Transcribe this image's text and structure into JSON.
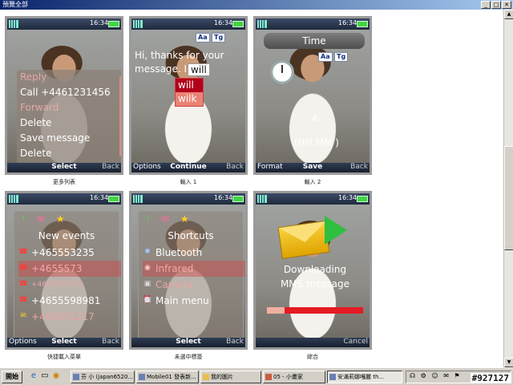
{
  "window": {
    "title": "預覽全部",
    "buttons": [
      "_",
      "□",
      "✕"
    ]
  },
  "top_captions": [
    "",
    "",
    "",
    ""
  ],
  "screens": [
    {
      "caption": "更多列表",
      "clock": "16:34",
      "softkeys": {
        "left": "",
        "center": "Select",
        "right": "Back"
      },
      "menu": [
        "Reply",
        "Call +4461231456",
        "Forward",
        "Delete",
        "Save message",
        "Delete"
      ]
    },
    {
      "caption": "輸入 1",
      "clock": "16:34",
      "badges": [
        "Aa",
        "Tg"
      ],
      "message": "Hi, thanks for your message. I",
      "cursor_word": "will",
      "suggestions": [
        "will",
        "wilk"
      ],
      "softkeys": {
        "left": "Options",
        "center": "Continue",
        "right": "Back"
      }
    },
    {
      "caption": "輸入 2",
      "clock": "16:34",
      "header": "Time",
      "badges": [
        "Aa",
        "Tg"
      ],
      "time_value": "4:",
      "time_format": "(HH:MM )",
      "softkeys": {
        "left": "Format",
        "center": "Save",
        "right": "Back"
      }
    },
    {
      "caption": "快捷載入菜單",
      "clock": "16:34",
      "title": "New events",
      "icons": [
        "!",
        "✉",
        "★"
      ],
      "items": [
        "+465553235",
        "+4655573",
        "+4655591530",
        "+4655598981",
        "+468851217"
      ],
      "softkeys": {
        "left": "Options",
        "center": "Select",
        "right": "Back"
      }
    },
    {
      "caption": "未選中標簽",
      "clock": "16:34",
      "title": "Shortcuts",
      "icons": [
        "!",
        "✉",
        "★"
      ],
      "items": [
        "Bluetooth",
        "Infrared",
        "Camera",
        "",
        "Main menu"
      ],
      "softkeys": {
        "left": "",
        "center": "Select",
        "right": "Back"
      }
    },
    {
      "caption": "綜合",
      "clock": "16:34",
      "status_lines": [
        "Downloading",
        "MMS message"
      ],
      "progress": 0.82,
      "softkeys": {
        "left": "",
        "center": "",
        "right": "Cancel"
      }
    }
  ],
  "taskbar": {
    "start": "開始",
    "tasks": [
      "芬 小 (japan6520...",
      "Mobile01 發表新...",
      "我的圖片",
      "05 - 小畫家",
      "安滿莉娜嘎麗 th..."
    ],
    "tray_icons": "☊ ⚙ ☺ ✉ ⚑",
    "watermark": "#927127"
  },
  "colors": {
    "accent_red": "#e31b23",
    "titlebar": "#0a246a",
    "battery": "#41d447"
  }
}
